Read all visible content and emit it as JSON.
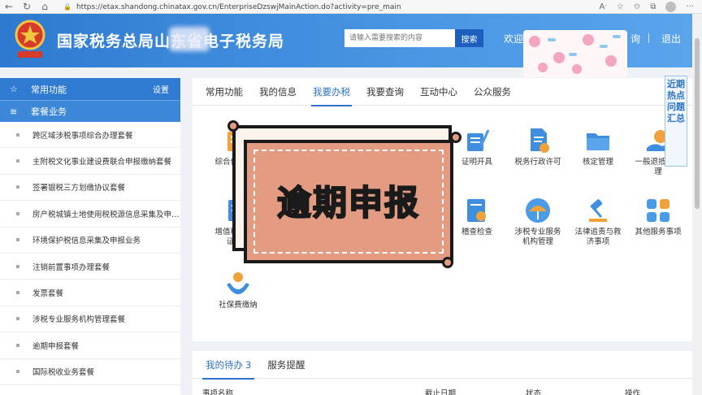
{
  "browser": {
    "url": "https://etax.shandong.chinatax.gov.cn/EnterpriseDzswjMainAction.do?activity=pre_main"
  },
  "header": {
    "title": "国家税务总局山东省电子税务局",
    "search_placeholder": "请输入需要搜索的内容",
    "search_button": "搜索",
    "welcome": "欢迎",
    "link_partial": "询",
    "logout": "退出"
  },
  "sidebar": {
    "common": "常用功能",
    "settings": "设置",
    "packages": "套餐业务",
    "items": [
      "跨区域涉税事项综合办理套餐",
      "主附税文化事业建设费联合申报缴纳套餐",
      "签署银税三方划缴协议套餐",
      "房产税城镇土地使用税税源信息采集及申…",
      "环境保护税信息采集及申报业务",
      "注销前置事项办理套餐",
      "发票套餐",
      "涉税专业服务机构管理套餐",
      "逾期申报套餐",
      "国际税收业务套餐"
    ]
  },
  "tabs": [
    "常用功能",
    "我的信息",
    "我要办税",
    "我要查询",
    "互动中心",
    "公众服务"
  ],
  "services_row1": [
    {
      "label": "综合信息报告",
      "icon": "report-icon"
    },
    {
      "label": "证明开具",
      "icon": "certificate-icon"
    },
    {
      "label": "税务行政许可",
      "icon": "license-icon"
    },
    {
      "label": "核定管理",
      "icon": "folder-icon"
    },
    {
      "label": "一般退抵税管理",
      "icon": "refund-icon"
    }
  ],
  "services_row2": [
    {
      "label": "增值税抵扣凭证管理",
      "icon": "voucher-icon"
    },
    {
      "label": "稽查检查",
      "icon": "inspection-icon"
    },
    {
      "label": "涉税专业服务机构管理",
      "icon": "umbrella-icon"
    },
    {
      "label": "法律追责与救济事项",
      "icon": "gavel-icon"
    },
    {
      "label": "其他服务事项",
      "icon": "grid-icon"
    }
  ],
  "services_row3": [
    {
      "label": "社保费缴纳",
      "icon": "social-security-icon"
    }
  ],
  "overlay": {
    "text": "逾期申报"
  },
  "float_panel": {
    "text": "近期热点问题汇总"
  },
  "todo": {
    "tab_mine": "我的待办",
    "count": "3",
    "tab_reminder": "服务提醒",
    "col_item": "事项名称",
    "col_deadline": "截止日期",
    "col_status": "状态",
    "col_action": "操作"
  },
  "colors": {
    "header_blue": "#2e7ad0",
    "sidebar_blue": "#2f7bd1",
    "active_tab": "#2d73c7",
    "banner_fill": "#e39b82",
    "banner_text": "#ffe21a"
  }
}
